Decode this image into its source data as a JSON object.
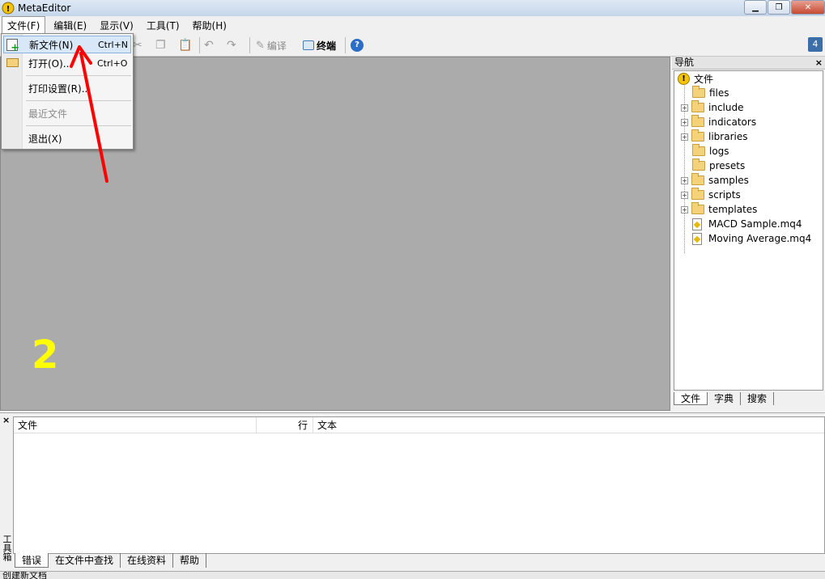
{
  "window": {
    "title": "MetaEditor"
  },
  "menubar": {
    "items": [
      "文件(F)",
      "编辑(E)",
      "显示(V)",
      "工具(T)",
      "帮助(H)"
    ]
  },
  "toolbar": {
    "compile_label": "编译",
    "terminal_label": "终端",
    "badge": "4"
  },
  "file_menu": {
    "items": [
      {
        "label": "新文件(N)",
        "shortcut": "Ctrl+N"
      },
      {
        "label": "打开(O)...",
        "shortcut": "Ctrl+O"
      },
      {
        "label": "打印设置(R)...",
        "shortcut": ""
      },
      {
        "label": "最近文件",
        "shortcut": ""
      },
      {
        "label": "退出(X)",
        "shortcut": ""
      }
    ]
  },
  "workspace": {
    "overlay_number": "2"
  },
  "navigator": {
    "title": "导航",
    "root": "文件",
    "items": [
      {
        "label": "files",
        "type": "folder",
        "expandable": false
      },
      {
        "label": "include",
        "type": "folder",
        "expandable": true
      },
      {
        "label": "indicators",
        "type": "folder",
        "expandable": true
      },
      {
        "label": "libraries",
        "type": "folder",
        "expandable": true
      },
      {
        "label": "logs",
        "type": "folder",
        "expandable": false
      },
      {
        "label": "presets",
        "type": "folder",
        "expandable": false
      },
      {
        "label": "samples",
        "type": "folder",
        "expandable": true
      },
      {
        "label": "scripts",
        "type": "folder",
        "expandable": true
      },
      {
        "label": "templates",
        "type": "folder",
        "expandable": true
      },
      {
        "label": "MACD Sample.mq4",
        "type": "file",
        "expandable": false
      },
      {
        "label": "Moving Average.mq4",
        "type": "file",
        "expandable": false
      }
    ],
    "tabs": [
      "文件",
      "字典",
      "搜索"
    ]
  },
  "toolbox": {
    "side_label": "工具箱",
    "columns": [
      "文件",
      "行",
      "文本"
    ],
    "tabs": [
      "错误",
      "在文件中查找",
      "在线资料",
      "帮助"
    ]
  },
  "statusbar": {
    "text": "创建新文档"
  },
  "colors": {
    "overlay_number": "#ffff00",
    "arrow": "#ff0000",
    "workspace_bg": "#ababab"
  }
}
